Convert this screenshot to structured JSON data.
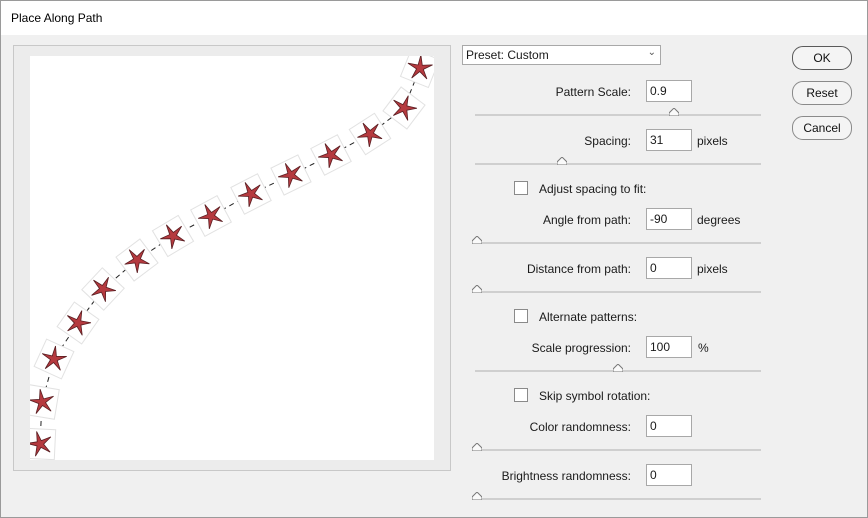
{
  "window": {
    "title": "Place Along Path"
  },
  "preset": {
    "label": "Preset: Custom"
  },
  "buttons": {
    "ok": "OK",
    "reset": "Reset",
    "cancel": "Cancel"
  },
  "fields": {
    "pattern_scale": {
      "label": "Pattern Scale:",
      "value": "0.9",
      "slider": 0.7
    },
    "spacing": {
      "label": "Spacing:",
      "value": "31",
      "unit": "pixels",
      "slider": 0.3
    },
    "adjust_spacing": {
      "label": "Adjust spacing to fit:",
      "checked": false
    },
    "angle": {
      "label": "Angle from path:",
      "value": "-90",
      "unit": "degrees",
      "slider": 0.0
    },
    "distance": {
      "label": "Distance from path:",
      "value": "0",
      "unit": "pixels",
      "slider": 0.0
    },
    "alternate": {
      "label": "Alternate patterns:",
      "checked": false
    },
    "scale_progression": {
      "label": "Scale progression:",
      "value": "100",
      "unit": "%",
      "slider": 0.5
    },
    "skip_rotation": {
      "label": "Skip symbol rotation:",
      "checked": false
    },
    "color_randomness": {
      "label": "Color randomness:",
      "value": "0",
      "slider": 0.0
    },
    "brightness_randomness": {
      "label": "Brightness randomness:",
      "value": "0",
      "slider": 0.0
    }
  },
  "colors": {
    "star_fill": "#b53a3f",
    "star_stroke": "#5a1e22"
  }
}
